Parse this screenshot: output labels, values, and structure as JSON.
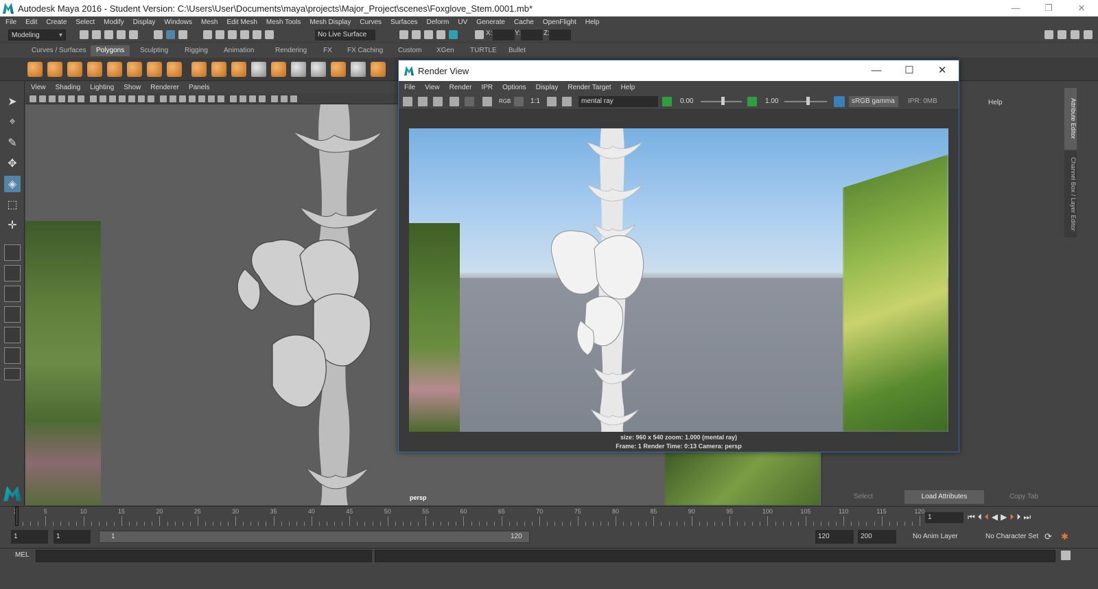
{
  "window": {
    "title": "Autodesk Maya 2016 - Student Version: C:\\Users\\User\\Documents\\maya\\projects\\Major_Project\\scenes\\Foxglove_Stem.0001.mb*",
    "controls": [
      "—",
      "❐",
      "✕"
    ]
  },
  "menubar": [
    "File",
    "Edit",
    "Create",
    "Select",
    "Modify",
    "Display",
    "Windows",
    "Mesh",
    "Edit Mesh",
    "Mesh Tools",
    "Mesh Display",
    "Curves",
    "Surfaces",
    "Deform",
    "UV",
    "Generate",
    "Cache",
    "OpenFlight",
    "Help"
  ],
  "statusline": {
    "mode": "Modeling",
    "live_surface": "No Live Surface",
    "x_label": "X:",
    "y_label": "Y:",
    "z_label": "Z:"
  },
  "shelf": {
    "tabs": [
      "Curves / Surfaces",
      "Polygons",
      "Sculpting",
      "Rigging",
      "Animation",
      "Rendering",
      "FX",
      "FX Caching",
      "Custom",
      "XGen",
      "TURTLE",
      "Bullet"
    ],
    "active_tab": "Polygons"
  },
  "viewport": {
    "menu": [
      "View",
      "Shading",
      "Lighting",
      "Show",
      "Renderer",
      "Panels"
    ],
    "camera_label": "persp"
  },
  "render_view": {
    "title": "Render View",
    "controls": [
      "—",
      "☐",
      "✕"
    ],
    "menu": [
      "File",
      "View",
      "Render",
      "IPR",
      "Options",
      "Display",
      "Render Target",
      "Help"
    ],
    "ratio": "1:1",
    "rgb_label": "RGB",
    "renderer": "mental ray",
    "exposure": "0.00",
    "gamma": "1.00",
    "color_space": "sRGB gamma",
    "ipr_mem": "IPR: 0MB",
    "info_line1": "size: 960 x 540 zoom: 1.000       (mental ray)",
    "info_line2": "Frame: 1       Render Time: 0:13       Camera: persp"
  },
  "right_panel": {
    "help": "Help",
    "buttons": [
      "Select",
      "Load Attributes",
      "Copy Tab"
    ],
    "side_tabs": [
      "Attribute Editor",
      "Channel Box / Layer Editor"
    ]
  },
  "timeslider": {
    "ticks": [
      1,
      5,
      10,
      15,
      20,
      25,
      30,
      35,
      40,
      45,
      50,
      55,
      60,
      65,
      70,
      75,
      80,
      85,
      90,
      95,
      100,
      105,
      110,
      115,
      120
    ],
    "current_frame": "1"
  },
  "rangeslider": {
    "start": "1",
    "playback_start": "1",
    "range_start": "1",
    "range_end": "120",
    "playback_end": "120",
    "end": "200",
    "anim_layer": "No Anim Layer",
    "character_set": "No Character Set"
  },
  "cmdline": {
    "label": "MEL"
  }
}
